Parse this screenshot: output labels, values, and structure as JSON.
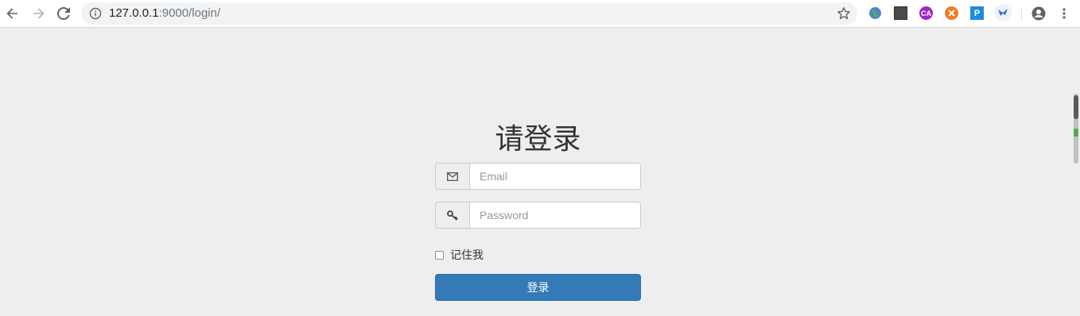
{
  "browser": {
    "url_host": "127.0.0.1",
    "url_path": ":9000/login/",
    "back_icon": "arrow-left-icon",
    "forward_icon": "arrow-right-icon",
    "reload_icon": "reload-icon",
    "info_icon": "info-icon",
    "bookmark_icon": "star-icon",
    "extensions": [
      {
        "name": "globe-extension-icon",
        "label": ""
      },
      {
        "name": "dark-square-extension-icon",
        "label": ""
      },
      {
        "name": "ca-extension-icon",
        "label": "CA"
      },
      {
        "name": "orange-extension-icon",
        "label": ""
      },
      {
        "name": "p-extension-icon",
        "label": "P"
      },
      {
        "name": "bird-extension-icon",
        "label": ""
      }
    ],
    "profile_icon": "account-icon",
    "menu_icon": "more-vert-icon"
  },
  "login": {
    "title": "请登录",
    "email_placeholder": "Email",
    "email_icon": "envelope-icon",
    "password_placeholder": "Password",
    "password_icon": "key-icon",
    "remember_label": "记住我",
    "submit_label": "登录"
  },
  "colors": {
    "page_bg": "#eeeeee",
    "primary": "#337ab7",
    "text": "#333333"
  }
}
